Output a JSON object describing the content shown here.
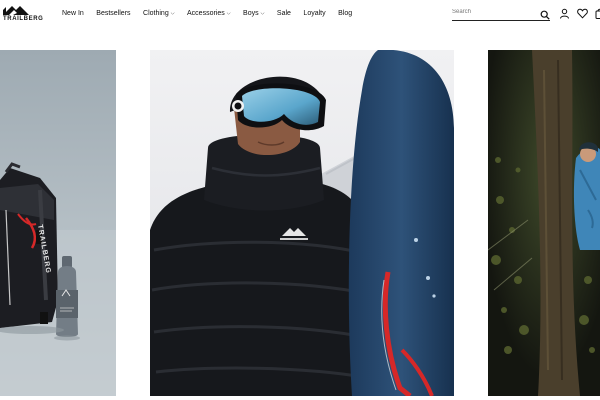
{
  "brand": {
    "name": "TRAILBERG"
  },
  "nav": {
    "items": [
      {
        "label": "New In",
        "dropdown": false
      },
      {
        "label": "Bestsellers",
        "dropdown": false
      },
      {
        "label": "Clothing",
        "dropdown": true
      },
      {
        "label": "Accessories",
        "dropdown": true
      },
      {
        "label": "Boys",
        "dropdown": true
      },
      {
        "label": "Sale",
        "dropdown": false
      },
      {
        "label": "Loyalty",
        "dropdown": false
      },
      {
        "label": "Blog",
        "dropdown": false
      }
    ],
    "dropdown_glyph": "⌵"
  },
  "search": {
    "placeholder": "Search",
    "value": ""
  },
  "header_icons": [
    "search-icon",
    "account-icon",
    "wishlist-heart-icon",
    "cart-bag-icon"
  ],
  "tiles": [
    {
      "subject": "backpack-and-bottle-product-photo",
      "bag_print": "TRAILBERG"
    },
    {
      "subject": "person-in-black-puffer-jacket-with-ski-goggles-and-snowboard"
    },
    {
      "subject": "person-in-blue-jacket-in-night-forest"
    }
  ],
  "colors": {
    "text": "#111111",
    "background": "#ffffff",
    "accent_red": "#d62828"
  }
}
